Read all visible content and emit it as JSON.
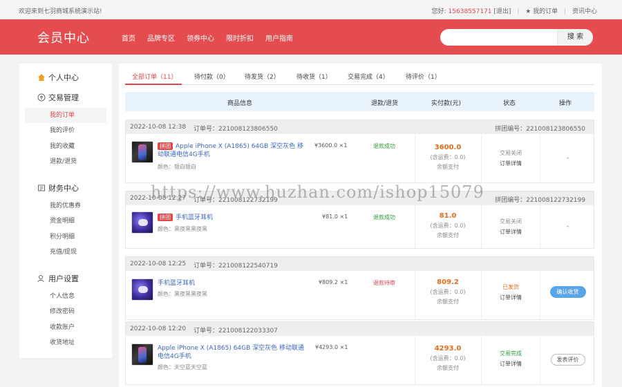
{
  "topbar": {
    "welcome": "欢迎来到七羽商城系统演示站!",
    "greeting": "您好:",
    "phone": "15638557171",
    "logout": "[退出]",
    "my_orders": "★ 我的订单",
    "news": "资讯中心"
  },
  "header": {
    "title": "会员中心",
    "nav": [
      "首页",
      "品牌专区",
      "领券中心",
      "限时折扣",
      "用户指南"
    ],
    "search_placeholder": "",
    "search_button": "搜 索"
  },
  "sidebar": {
    "sections": [
      {
        "label": "个人中心",
        "icon": "home-icon",
        "items": []
      },
      {
        "label": "交易管理",
        "icon": "trade-icon",
        "items": [
          "我的订单",
          "我的评价",
          "我的收藏",
          "退款/退货"
        ]
      },
      {
        "label": "财务中心",
        "icon": "wallet-icon",
        "items": [
          "我的优惠券",
          "资金明细",
          "积分明细",
          "充值/提现"
        ]
      },
      {
        "label": "用户设置",
        "icon": "user-icon",
        "items": [
          "个人信息",
          "修改密码",
          "收款账户",
          "收货地址"
        ]
      }
    ],
    "active_item": "我的订单"
  },
  "tabs": [
    "全部订单（11）",
    "待付款（0）",
    "待发货（2）",
    "待收货（1）",
    "交易完成（4）",
    "待评价（1）"
  ],
  "table_headers": [
    "商品信息",
    "退款/退货",
    "实付款(元)",
    "状态",
    "操作"
  ],
  "orders": [
    {
      "date": "2022-10-08 12:38",
      "order_no": "订单号：221008123806550",
      "group_no": "拼团编号：221008123806550",
      "badge": "拼团",
      "product": "Apple iPhone X (A1865) 64GB 深空灰色 移动联通电信4G手机",
      "color": "颜色：银白银白",
      "price": "¥3600.0 ×1",
      "refund": "退款成功",
      "amount": "3600.0",
      "shipping": "(含运费：0.0)",
      "pay_method": "余额支付",
      "status": "交易关闭",
      "detail": "订单详情",
      "action": "-",
      "image": "phone"
    },
    {
      "date": "2022-10-08 12:27",
      "order_no": "订单号：221008122732199",
      "group_no": "拼团编号：221008122732199",
      "badge": "拼团",
      "product": "手机蓝牙耳机",
      "color": "颜色：黑夜黑黑夜黑",
      "price": "¥81.0 ×1",
      "refund": "退款成功",
      "amount": "81.0",
      "shipping": "(含运费：0.0)",
      "pay_method": "余额支付",
      "status": "交易关闭",
      "detail": "订单详情",
      "action": "-",
      "image": "ear"
    },
    {
      "date": "2022-10-08 12:25",
      "order_no": "订单号：221008122540719",
      "group_no": "",
      "badge": "",
      "product": "手机蓝牙耳机",
      "color": "颜色：黑夜黑黑夜黑",
      "price": "¥809.2 ×1",
      "refund": "退款待审",
      "amount": "809.2",
      "shipping": "(含运费：0.0)",
      "pay_method": "余额支付",
      "status": "已发货",
      "detail": "订单详情",
      "action": "确认收货",
      "image": "ear"
    },
    {
      "date": "2022-10-08 12:20",
      "order_no": "订单号：221008122033307",
      "group_no": "",
      "badge": "",
      "product": "Apple iPhone X (A1865) 64GB 深空灰色 移动联通电信4G手机",
      "color": "颜色：天空蓝天空蓝",
      "price": "¥4293.0 ×1",
      "refund": "",
      "amount": "4293.0",
      "shipping": "(含运费：0.0)",
      "pay_method": "余额支付",
      "status": "交易完成",
      "detail": "订单详情",
      "action": "发表评价",
      "image": "phone"
    }
  ],
  "watermark": "https://www.huzhan.com/ishop15079",
  "colors": {
    "brand": "#e44c4f",
    "accent_orange": "#e46c1a",
    "refund_green": "#2e9b3c",
    "refund_red": "#e0474c",
    "confirm_blue": "#5aa5ea"
  }
}
